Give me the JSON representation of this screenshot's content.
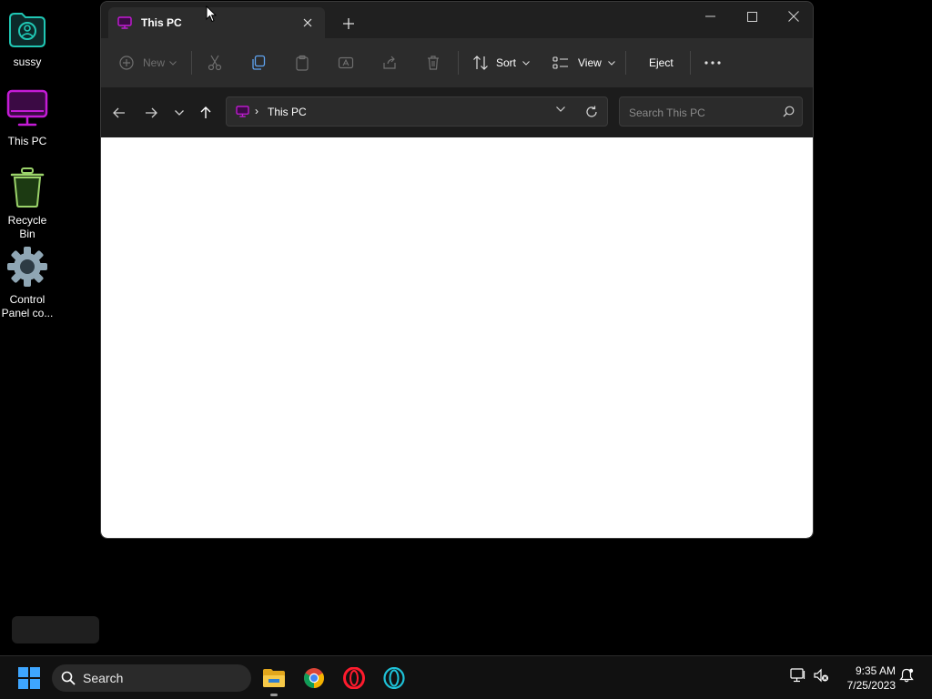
{
  "desktop": {
    "icons": [
      {
        "label": "sussy",
        "icon": "user-folder-icon"
      },
      {
        "label": "This PC",
        "icon": "monitor-icon"
      },
      {
        "label": "Recycle\nBin",
        "icon": "recycle-bin-icon"
      },
      {
        "label": "Control\nPanel co...",
        "icon": "gear-icon"
      }
    ]
  },
  "window": {
    "tab_title": "This PC",
    "toolbar": {
      "new_label": "New",
      "sort_label": "Sort",
      "view_label": "View",
      "eject_label": "Eject"
    },
    "address": {
      "crumb": "This PC"
    },
    "search": {
      "placeholder": "Search This PC"
    }
  },
  "taskbar": {
    "search_label": "Search",
    "time": "9:35 AM",
    "date": "7/25/2023",
    "apps": [
      "file-explorer",
      "chrome",
      "opera",
      "opera-gx"
    ]
  },
  "colors": {
    "accent_pc": "#c41bd6",
    "neon_teal": "#20c7b4",
    "neon_green": "#9bd36a",
    "window_bg": "#202020",
    "content_bg": "#ffffff",
    "taskbar_bg": "#111111"
  }
}
